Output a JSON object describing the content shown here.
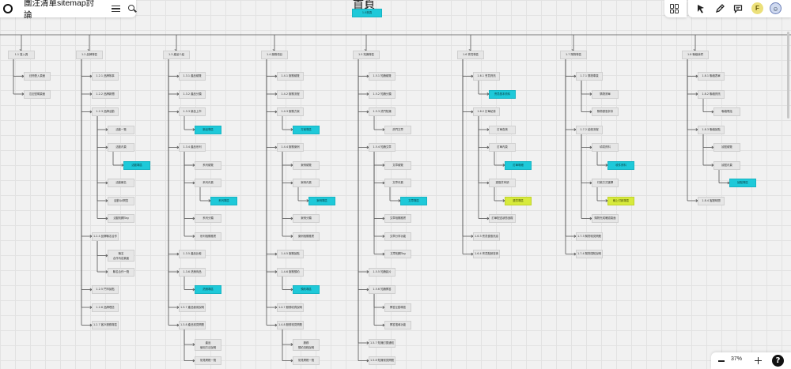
{
  "toolbar": {
    "title": "團注清單sitemap討論",
    "zoom_label": "37%",
    "help_label": "?",
    "avatar_f": "F",
    "avatar_2": "☺"
  },
  "diagram": {
    "heading": "首頁",
    "icon_names": [
      "logo-icon",
      "menu-icon",
      "search-icon",
      "grid-icon",
      "cursor-icon",
      "pen-icon",
      "comment-icon"
    ],
    "colors": {
      "highlight": "#1ec9d9",
      "accent": "#d7ea3c",
      "node": "#e6e6e6",
      "line": "#555555"
    },
    "root": "1.0首頁",
    "sections": [
      {
        "label": "1.1 登入頁",
        "children": [
          {
            "label": "註冊登入頁面"
          },
          {
            "label": "忘記密碼頁面"
          }
        ]
      },
      {
        "label": "1.2 品牌專區",
        "children": [
          {
            "label": "1.2.1 品牌故事"
          },
          {
            "label": "1.2.2 品牌新聞"
          },
          {
            "label": "1.2.3 品牌活動",
            "children": [
              {
                "label": "活動一覽"
              },
              {
                "label": "活動內頁",
                "children": [
                  {
                    "label": "活動專區",
                    "hl": "cyan"
                  }
                ]
              },
              {
                "label": "活動報名"
              },
              {
                "label": "活動QA問答"
              },
              {
                "label": "活動相關Tag"
              }
            ]
          },
          {
            "label": "1.2.4 品牌聯名合作",
            "children": [
              {
                "label": "聯名\n合作內容頁面"
              },
              {
                "label": "聯名合作一覽"
              }
            ]
          },
          {
            "label": "1.2.5 門市據點"
          },
          {
            "label": "1.2.6 品牌理念"
          },
          {
            "label": "1.2.7 客戶服務專區"
          }
        ]
      },
      {
        "label": "1.3 產品介紹",
        "children": [
          {
            "label": "1.3.1 產品總覽"
          },
          {
            "label": "1.3.2 產品分類"
          },
          {
            "label": "1.3.3 新品上市",
            "children": [
              {
                "label": "新品專區",
                "hl": "cyan"
              }
            ]
          },
          {
            "label": "1.3.4 產品系列",
            "children": [
              {
                "label": "系列總覽"
              },
              {
                "label": "系列內頁",
                "children": [
                  {
                    "label": "系列專區",
                    "hl": "cyan"
                  }
                ]
              },
              {
                "label": "系列分類"
              },
              {
                "label": "系列相關推薦"
              }
            ]
          },
          {
            "label": "1.3.5 產品比較"
          },
          {
            "label": "1.3.6 熱銷商品",
            "children": [
              {
                "label": "熱銷專區",
                "hl": "cyan"
              }
            ]
          },
          {
            "label": "1.3.7 產品使用說明"
          },
          {
            "label": "1.3.8 產品常見問題",
            "children": [
              {
                "label": "產品\n使用方法說明"
              },
              {
                "label": "常見問題一覽"
              }
            ]
          }
        ]
      },
      {
        "label": "1.4 服務項目",
        "children": [
          {
            "label": "1.4.1 服務總覽"
          },
          {
            "label": "1.4.2 服務流程"
          },
          {
            "label": "1.4.3 服務方案",
            "children": [
              {
                "label": "方案專區",
                "hl": "cyan"
              }
            ]
          },
          {
            "label": "1.4.4 服務案例",
            "children": [
              {
                "label": "案例總覽"
              },
              {
                "label": "案例內頁",
                "children": [
                  {
                    "label": "案例專區",
                    "hl": "cyan"
                  }
                ]
              },
              {
                "label": "案例分類"
              },
              {
                "label": "案例相關推薦"
              }
            ]
          },
          {
            "label": "1.4.5 服務據點"
          },
          {
            "label": "1.4.6 服務預約",
            "children": [
              {
                "label": "預約專區",
                "hl": "cyan"
              }
            ]
          },
          {
            "label": "1.4.7 服務收費說明"
          },
          {
            "label": "1.4.8 服務常見問題",
            "children": [
              {
                "label": "服務\n預約流程說明"
              },
              {
                "label": "常見問題一覽"
              }
            ]
          }
        ]
      },
      {
        "label": "1.5 知識專區",
        "children": [
          {
            "label": "1.5.1 知識總覽"
          },
          {
            "label": "1.5.2 知識分類"
          },
          {
            "label": "1.5.3 熱門知識",
            "children": [
              {
                "label": "熱門文章"
              }
            ]
          },
          {
            "label": "1.5.4 知識文章",
            "children": [
              {
                "label": "文章總覽"
              },
              {
                "label": "文章內頁",
                "children": [
                  {
                    "label": "文章專區",
                    "hl": "cyan"
                  }
                ]
              },
              {
                "label": "文章相關推薦"
              },
              {
                "label": "文章分享功能"
              },
              {
                "label": "文章相關Tag"
              }
            ]
          },
          {
            "label": "1.5.5 知識影片"
          },
          {
            "label": "1.5.6 知識問答",
            "children": [
              {
                "label": "問答互動專區"
              },
              {
                "label": "問答搜尋功能"
              }
            ]
          },
          {
            "label": "1.5.7 知識訂閱通知"
          },
          {
            "label": "1.5.8 知識常見問題"
          }
        ]
      },
      {
        "label": "1.6 會員專區",
        "children": [
          {
            "label": "1.6.1 會員資訊",
            "children": [
              {
                "label": "會員基本資料",
                "hl": "cyan"
              }
            ]
          },
          {
            "label": "1.6.2 訂單紀錄",
            "children": [
              {
                "label": "訂單查詢"
              },
              {
                "label": "訂單內頁",
                "children": [
                  {
                    "label": "訂單明細",
                    "hl": "cyan"
                  }
                ]
              },
              {
                "label": "退換貨申請",
                "children": [
                  {
                    "label": "退貨專區",
                    "hl": "lime"
                  }
                ]
              },
              {
                "label": "訂單配送狀態追蹤"
              }
            ]
          },
          {
            "label": "1.6.3 會員優惠訊息"
          },
          {
            "label": "1.6.4 會員點數查詢"
          }
        ]
      },
      {
        "label": "1.7 購物專區",
        "children": [
          {
            "label": "1.7.1 購物車頁",
            "children": [
              {
                "label": "購物清單"
              },
              {
                "label": "購物優惠折扣"
              }
            ]
          },
          {
            "label": "1.7.2 結帳流程",
            "children": [
              {
                "label": "填寫資料",
                "children": [
                  {
                    "label": "收件資料",
                    "hl": "cyan"
                  }
                ]
              },
              {
                "label": "付款方式選擇",
                "children": [
                  {
                    "label": "線上付款專區",
                    "hl": "lime"
                  }
                ]
              },
              {
                "label": "購物完成確認頁面"
              }
            ]
          },
          {
            "label": "1.7.3 購物常見問題"
          },
          {
            "label": "1.7.4 購物須知說明"
          }
        ]
      },
      {
        "label": "1.8 聯絡我們",
        "children": [
          {
            "label": "1.8.1 聯絡表單"
          },
          {
            "label": "1.8.2 聯絡資訊",
            "children": [
              {
                "label": "聯絡電話"
              }
            ]
          },
          {
            "label": "1.8.3 聯絡據點",
            "children": [
              {
                "label": "據點總覽"
              },
              {
                "label": "據點內頁",
                "children": [
                  {
                    "label": "據點專區",
                    "hl": "cyan"
                  }
                ]
              }
            ]
          },
          {
            "label": "1.8.4 客服時間"
          }
        ]
      }
    ]
  }
}
